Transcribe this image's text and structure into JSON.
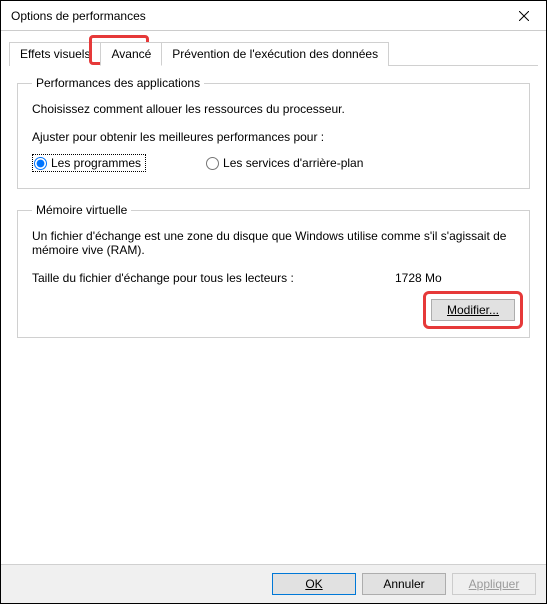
{
  "window": {
    "title": "Options de performances"
  },
  "tabs": {
    "visual": "Effets visuels",
    "advanced": "Avancé",
    "dep": "Prévention de l'exécution des données"
  },
  "appPerf": {
    "legend": "Performances des applications",
    "desc": "Choisissez comment allouer les ressources du processeur.",
    "adjustLabel": "Ajuster pour obtenir les meilleures performances pour :",
    "programs": "Les programmes",
    "services": "Les services d'arrière-plan"
  },
  "vm": {
    "legend": "Mémoire virtuelle",
    "desc": "Un fichier d'échange est une zone du disque que Windows utilise comme s'il s'agissait de mémoire vive (RAM).",
    "sizeLabel": "Taille du fichier d'échange pour tous les lecteurs :",
    "sizeValue": "1728 Mo",
    "modifyBtn": "Modifier..."
  },
  "footer": {
    "ok": "OK",
    "cancel": "Annuler",
    "apply": "Appliquer"
  }
}
